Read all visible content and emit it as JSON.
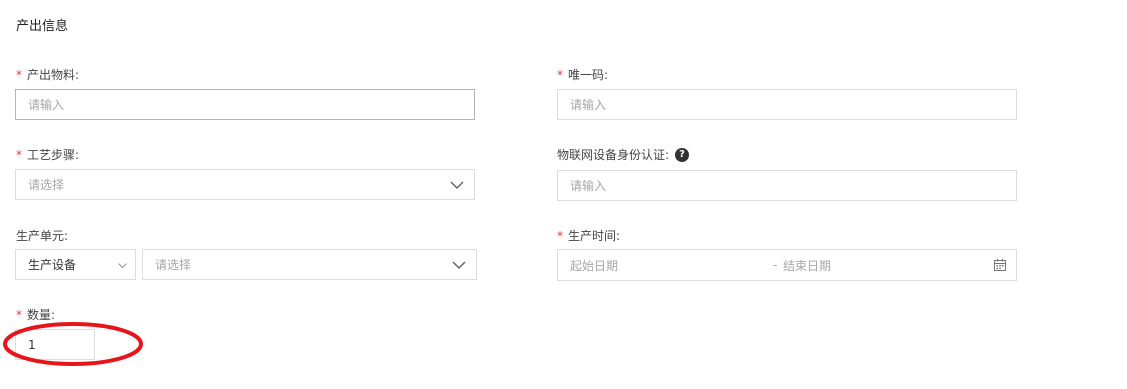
{
  "section": {
    "title": "产出信息"
  },
  "required_mark": "*",
  "fields": {
    "output_material": {
      "label": "产出物料:",
      "placeholder": "请输入"
    },
    "unique_code": {
      "label": "唯一码:",
      "placeholder": "请输入"
    },
    "process_step": {
      "label": "工艺步骤:",
      "placeholder": "请选择"
    },
    "iot_auth": {
      "label": "物联网设备身份认证:",
      "placeholder": "请输入",
      "help_icon": "question-circle-icon",
      "help_glyph": "?"
    },
    "production_unit": {
      "label": "生产单元:",
      "type_value": "生产设备",
      "placeholder": "请选择"
    },
    "production_time": {
      "label": "生产时间:",
      "start_placeholder": "起始日期",
      "separator": "-",
      "end_placeholder": "结束日期",
      "icon": "calendar-icon"
    },
    "quantity": {
      "label": "数量:",
      "value": "1"
    }
  },
  "annotation": {
    "color": "#e8141b"
  }
}
